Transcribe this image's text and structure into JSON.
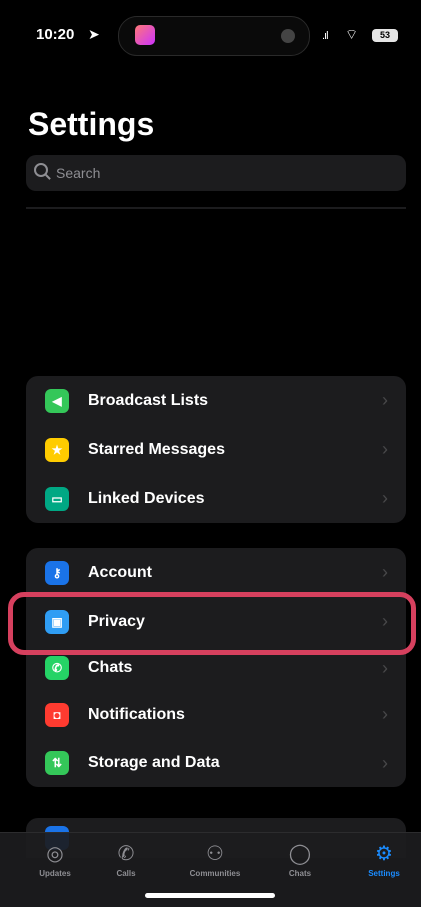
{
  "status_bar": {
    "time": "10:20",
    "signal": ".ıl",
    "battery": "53"
  },
  "header": {
    "title": "Settings"
  },
  "search": {
    "placeholder": "Search"
  },
  "group1": [
    {
      "label": "Broadcast Lists",
      "icon": "megaphone-icon",
      "color": "#34c759"
    },
    {
      "label": "Starred Messages",
      "icon": "star-icon",
      "color": "#ffcc00"
    },
    {
      "label": "Linked Devices",
      "icon": "laptop-icon",
      "color": "#00a884"
    }
  ],
  "group2": [
    {
      "label": "Account",
      "icon": "key-icon",
      "color": "#1a73e8"
    },
    {
      "label": "Privacy",
      "icon": "lock-icon",
      "color": "#2f9df4"
    },
    {
      "label": "Chats",
      "icon": "whatsapp-icon",
      "color": "#25d366"
    },
    {
      "label": "Notifications",
      "icon": "bell-icon",
      "color": "#ff3b30"
    },
    {
      "label": "Storage and Data",
      "icon": "arrows-icon",
      "color": "#34c759"
    }
  ],
  "tabs": [
    {
      "label": "Updates",
      "icon": "updates-icon",
      "active": false
    },
    {
      "label": "Calls",
      "icon": "phone-icon",
      "active": false
    },
    {
      "label": "Communities",
      "icon": "communities-icon",
      "active": false
    },
    {
      "label": "Chats",
      "icon": "chat-bubble-icon",
      "active": false
    },
    {
      "label": "Settings",
      "icon": "gear-icon",
      "active": true
    }
  ],
  "colors": {
    "highlight": "#d6405e",
    "accent": "#1a8cff"
  }
}
